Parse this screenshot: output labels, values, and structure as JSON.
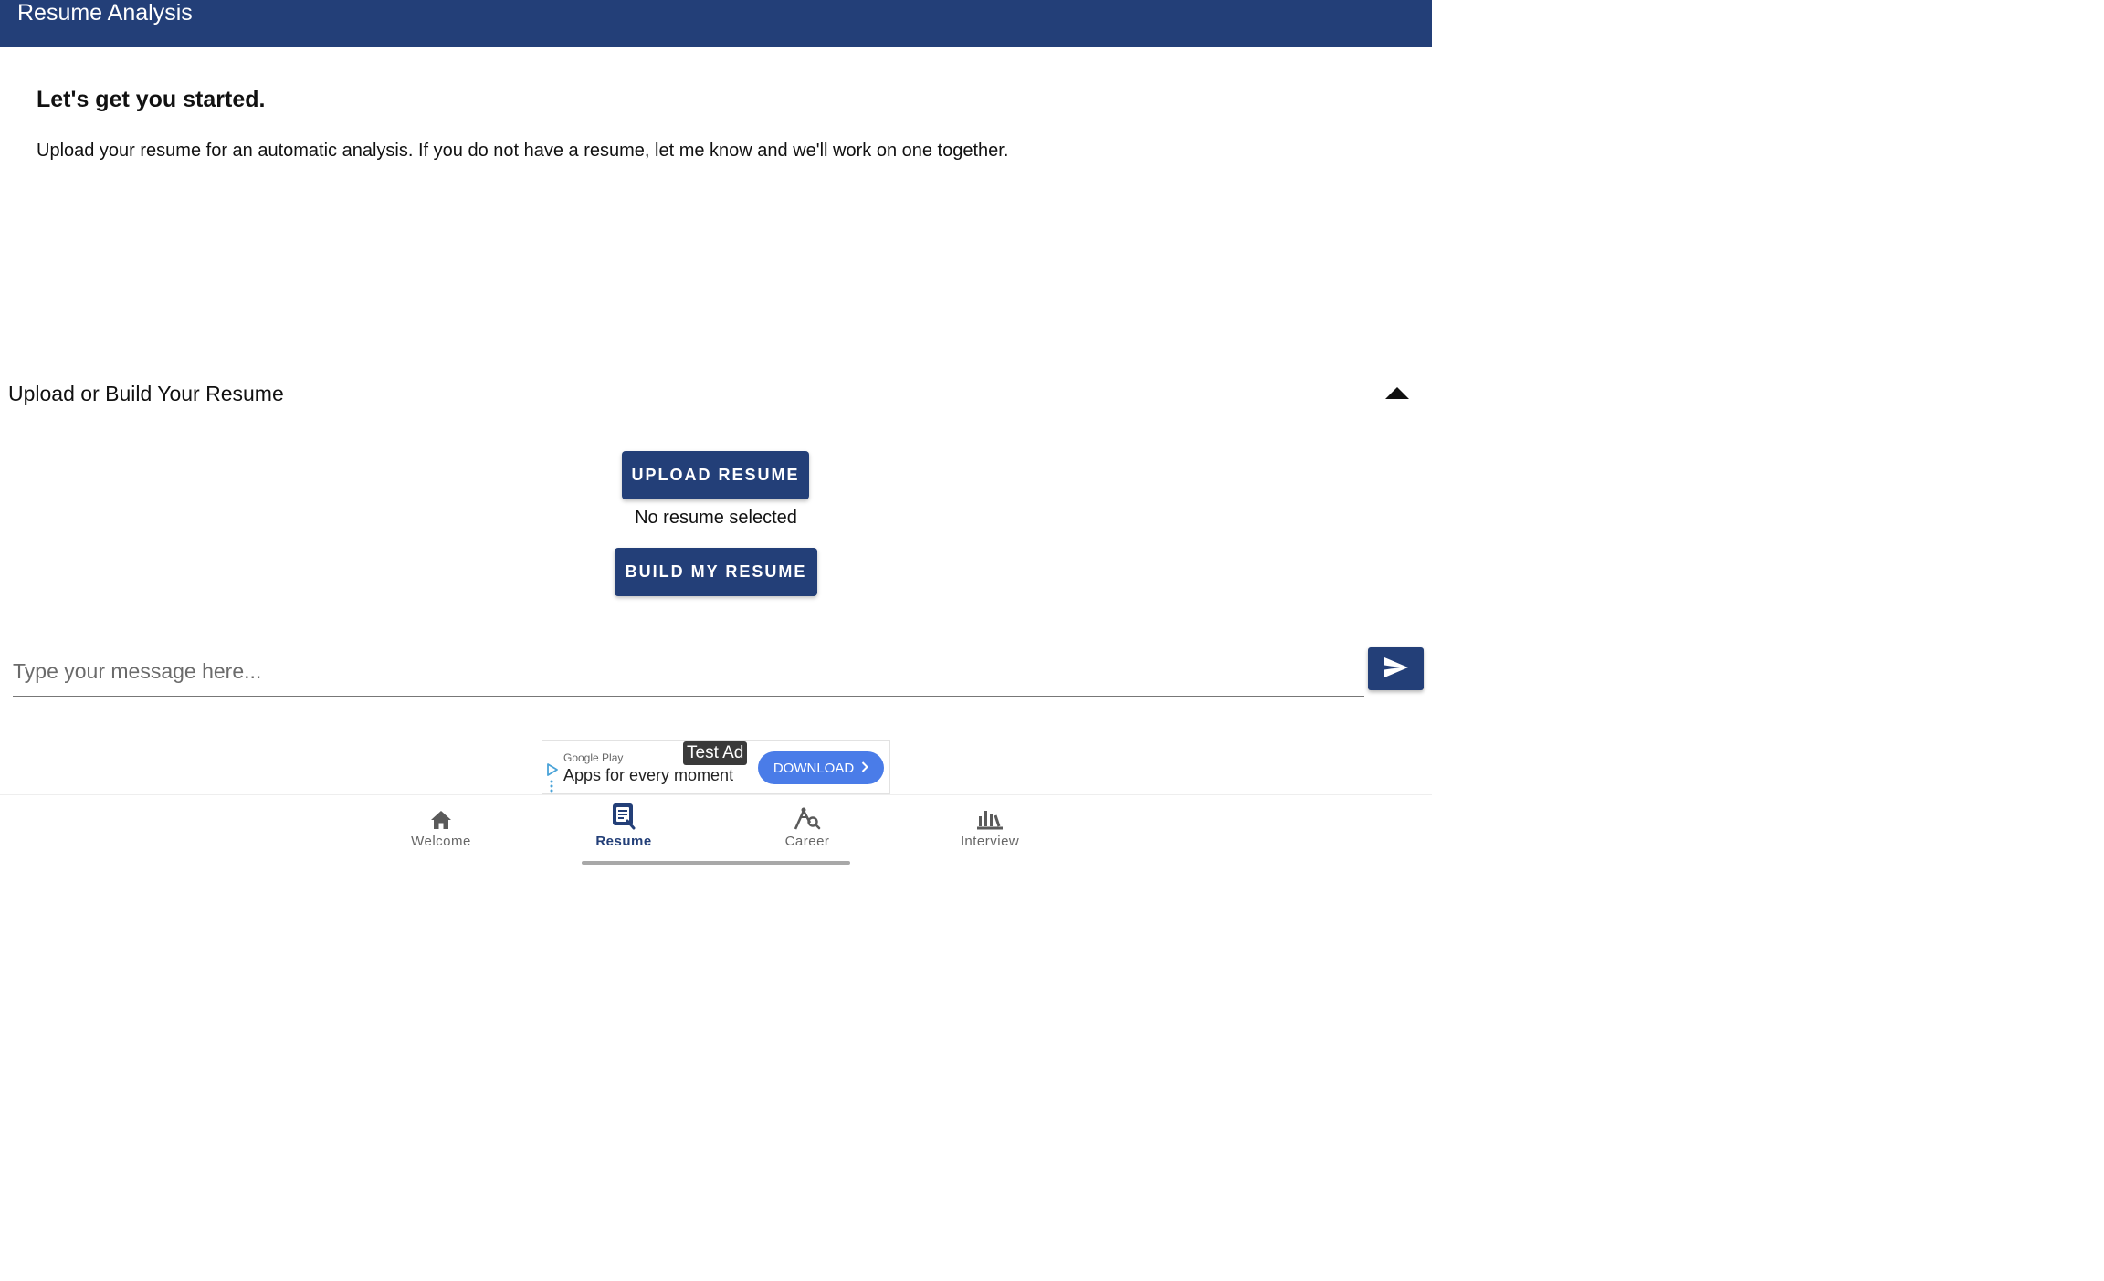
{
  "app_bar": {
    "title": "Resume Analysis"
  },
  "intro": {
    "heading": "Let's get you started.",
    "body": "Upload your resume for an automatic analysis. If you do not have a resume, let me know and we'll work on one together."
  },
  "section": {
    "title": "Upload or Build Your Resume",
    "toggle_icon": "caret-up-icon",
    "upload_button": "UPLOAD RESUME",
    "file_status": "No resume selected",
    "build_button": "BUILD MY RESUME"
  },
  "message": {
    "placeholder": "Type your message here...",
    "send_icon": "send-icon"
  },
  "ad": {
    "source": "Google Play",
    "headline": "Apps for every moment",
    "badge": "Test Ad",
    "cta": "DOWNLOAD"
  },
  "bottom_nav": {
    "items": [
      {
        "label": "Welcome",
        "icon": "home-icon",
        "active": false
      },
      {
        "label": "Resume",
        "icon": "resume-icon",
        "active": true
      },
      {
        "label": "Career",
        "icon": "career-search-icon",
        "active": false
      },
      {
        "label": "Interview",
        "icon": "bar-chart-icon",
        "active": false
      }
    ]
  },
  "colors": {
    "primary": "#233f78",
    "ad_cta": "#4a7ce8",
    "nav_inactive": "#666666"
  }
}
